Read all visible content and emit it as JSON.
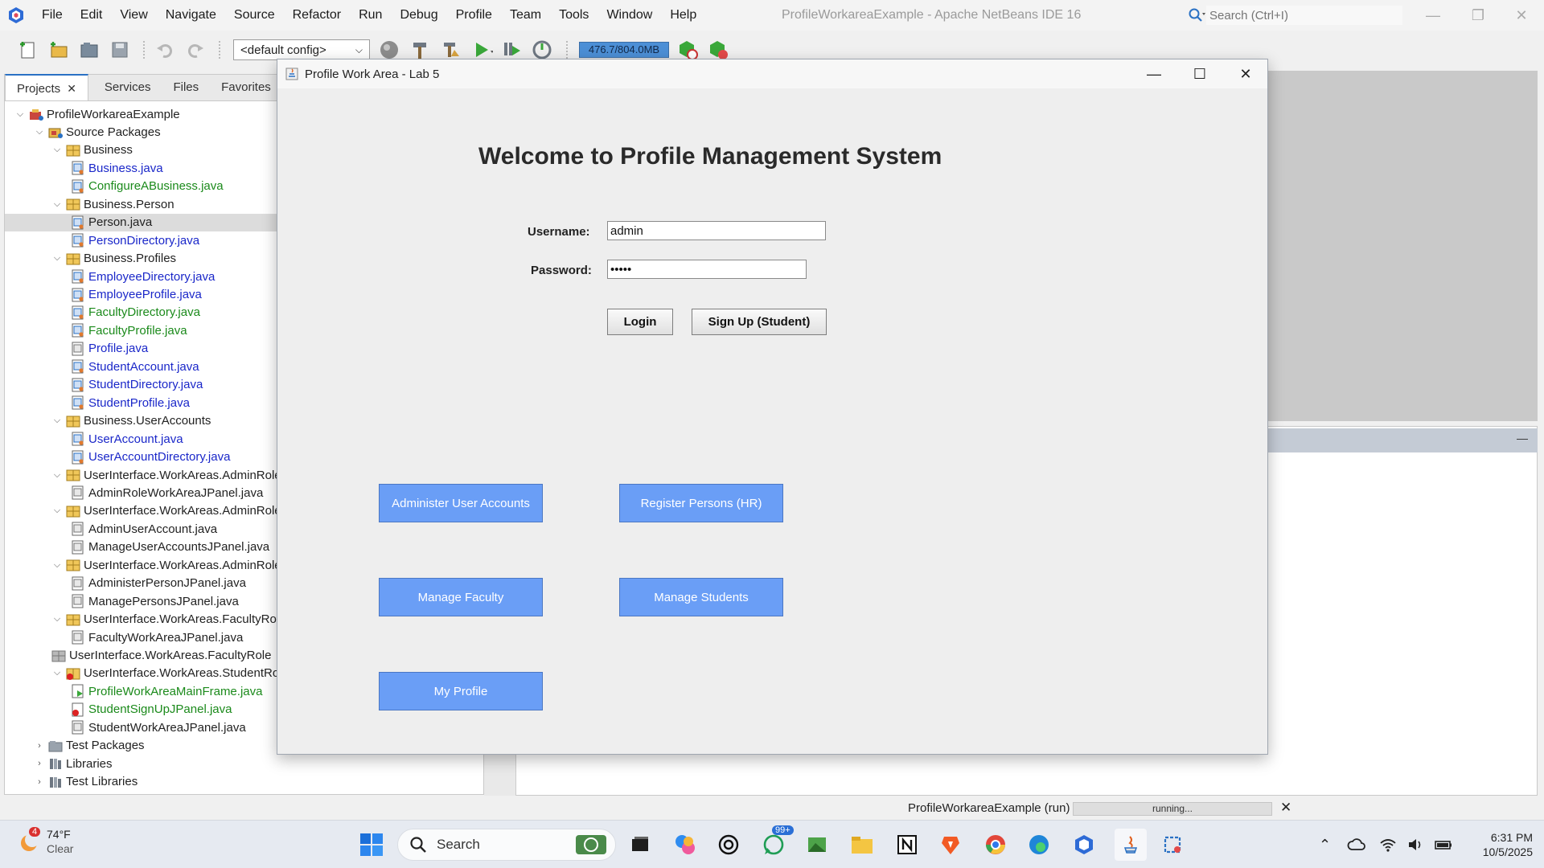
{
  "ide": {
    "window_title": "ProfileWorkareaExample - Apache NetBeans IDE 16",
    "menu": [
      "File",
      "Edit",
      "View",
      "Navigate",
      "Source",
      "Refactor",
      "Run",
      "Debug",
      "Profile",
      "Team",
      "Tools",
      "Window",
      "Help"
    ],
    "search_placeholder": "Search (Ctrl+I)",
    "config": "<default config>",
    "memory": "476.7/804.0MB",
    "accent_color": "#2a71c4"
  },
  "panel": {
    "tabs": [
      "Projects",
      "Services",
      "Files",
      "Favorites"
    ],
    "tree": [
      {
        "label": "ProfileWorkareaExample",
        "color": "black"
      },
      {
        "label": "Source Packages",
        "color": "black"
      },
      {
        "label": "Business",
        "color": "black"
      },
      {
        "label": "Business.java",
        "color": "blue"
      },
      {
        "label": "ConfigureABusiness.java",
        "color": "green"
      },
      {
        "label": "Business.Person",
        "color": "black"
      },
      {
        "label": "Person.java",
        "color": "black"
      },
      {
        "label": "PersonDirectory.java",
        "color": "blue"
      },
      {
        "label": "Business.Profiles",
        "color": "black"
      },
      {
        "label": "EmployeeDirectory.java",
        "color": "blue"
      },
      {
        "label": "EmployeeProfile.java",
        "color": "blue"
      },
      {
        "label": "FacultyDirectory.java",
        "color": "green"
      },
      {
        "label": "FacultyProfile.java",
        "color": "green"
      },
      {
        "label": "Profile.java",
        "color": "blue"
      },
      {
        "label": "StudentAccount.java",
        "color": "blue"
      },
      {
        "label": "StudentDirectory.java",
        "color": "blue"
      },
      {
        "label": "StudentProfile.java",
        "color": "blue"
      },
      {
        "label": "Business.UserAccounts",
        "color": "black"
      },
      {
        "label": "UserAccount.java",
        "color": "blue"
      },
      {
        "label": "UserAccountDirectory.java",
        "color": "blue"
      },
      {
        "label": "UserInterface.WorkAreas.AdminRole",
        "color": "black"
      },
      {
        "label": "AdminRoleWorkAreaJPanel.java",
        "color": "black"
      },
      {
        "label": "UserInterface.WorkAreas.AdminRole",
        "color": "black"
      },
      {
        "label": "AdminUserAccount.java",
        "color": "black"
      },
      {
        "label": "ManageUserAccountsJPanel.java",
        "color": "black"
      },
      {
        "label": "UserInterface.WorkAreas.AdminRole",
        "color": "black"
      },
      {
        "label": "AdministerPersonJPanel.java",
        "color": "black"
      },
      {
        "label": "ManagePersonsJPanel.java",
        "color": "black"
      },
      {
        "label": "UserInterface.WorkAreas.FacultyRole",
        "color": "black"
      },
      {
        "label": "FacultyWorkAreaJPanel.java",
        "color": "black"
      },
      {
        "label": "UserInterface.WorkAreas.FacultyRole",
        "color": "black"
      },
      {
        "label": "UserInterface.WorkAreas.StudentRol",
        "color": "black"
      },
      {
        "label": "ProfileWorkAreaMainFrame.java",
        "color": "green"
      },
      {
        "label": "StudentSignUpJPanel.java",
        "color": "green"
      },
      {
        "label": "StudentWorkAreaJPanel.java",
        "color": "black"
      },
      {
        "label": "Test Packages",
        "color": "black"
      },
      {
        "label": "Libraries",
        "color": "black"
      },
      {
        "label": "Test Libraries",
        "color": "black"
      }
    ]
  },
  "status": {
    "run_label": "ProfileWorkareaExample (run)",
    "progress_text": "running..."
  },
  "app": {
    "window_title": "Profile Work Area - Lab 5",
    "heading": "Welcome to Profile Management System",
    "username_label": "Username:",
    "username_value": "admin",
    "password_label": "Password:",
    "password_value": "•••••",
    "login_button": "Login",
    "signup_button": "Sign Up (Student)",
    "buttons": {
      "administer_user_accounts": "Administer User Accounts",
      "register_persons": "Register  Persons (HR)",
      "manage_faculty": "Manage Faculty",
      "manage_students": "Manage Students",
      "my_profile": "My Profile"
    },
    "button_color": "#6a9ef6"
  },
  "taskbar": {
    "weather_badge": "4",
    "weather_temp": "74°F",
    "weather_cond": "Clear",
    "search_label": "Search",
    "notif_badge": "99+",
    "time": "6:31 PM",
    "date": "10/5/2025"
  }
}
